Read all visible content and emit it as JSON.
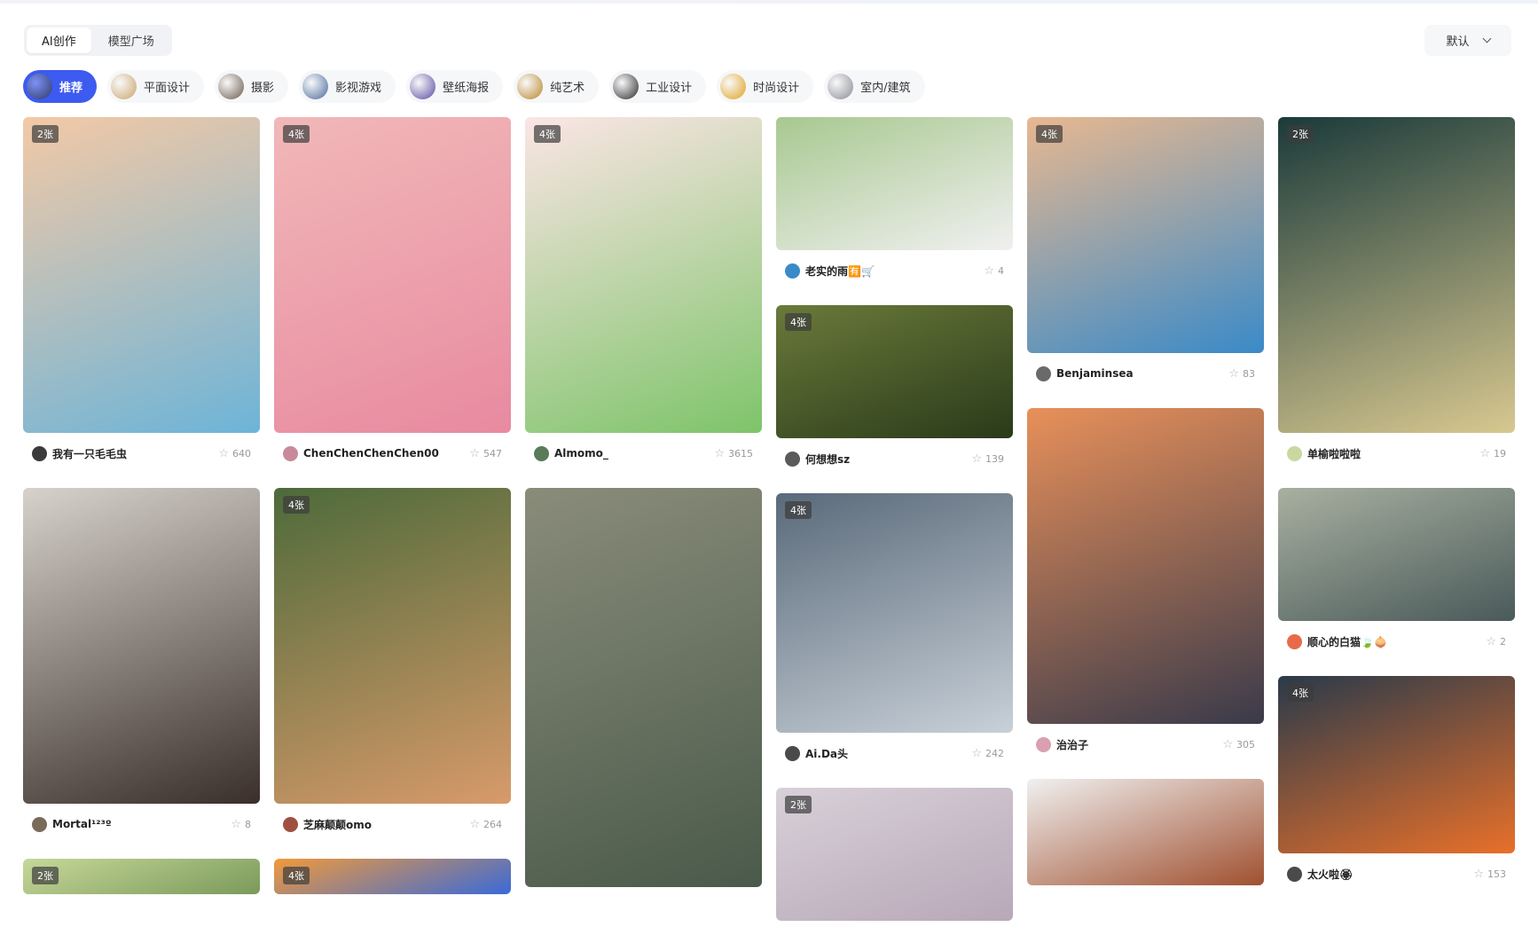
{
  "mode_tabs": [
    "AI创作",
    "模型广场"
  ],
  "sort": {
    "label": "默认",
    "icon": "chevron-down-icon"
  },
  "categories": [
    {
      "label": "推荐",
      "active": true,
      "color": "#2d3a66"
    },
    {
      "label": "平面设计",
      "active": false,
      "color": "#c9a46a"
    },
    {
      "label": "摄影",
      "active": false,
      "color": "#6b5a4a"
    },
    {
      "label": "影视游戏",
      "active": false,
      "color": "#4a6a9a"
    },
    {
      "label": "壁纸海报",
      "active": false,
      "color": "#5a4aa0"
    },
    {
      "label": "纯艺术",
      "active": false,
      "color": "#b8862a"
    },
    {
      "label": "工业设计",
      "active": false,
      "color": "#2a2a2a"
    },
    {
      "label": "时尚设计",
      "active": false,
      "color": "#e0a020"
    },
    {
      "label": "室内/建筑",
      "active": false,
      "color": "#8a8a94"
    }
  ],
  "columns": [
    [
      {
        "badge": "2张",
        "user": "我有一只毛毛虫",
        "fav": "640",
        "c1": "#f3c9a6",
        "c2": "#6db4d8",
        "avatar": "#3a3a3a"
      },
      {
        "badge": "",
        "user": "Mortal¹²³º",
        "fav": "8",
        "c1": "#d7d2cc",
        "c2": "#3a2f2a",
        "avatar": "#7a6a5a"
      },
      {
        "badge": "2张",
        "user": "",
        "fav": "",
        "c1": "#c7d89a",
        "c2": "#7a9a5a",
        "avatar": "#888"
      }
    ],
    [
      {
        "badge": "4张",
        "user": "ChenChenChenChen00",
        "fav": "547",
        "c1": "#f1b8b8",
        "c2": "#e88aa0",
        "avatar": "#c88a9a"
      },
      {
        "badge": "4张",
        "user": "芝麻颠颠omo",
        "fav": "264",
        "c1": "#4d6a3a",
        "c2": "#d89a6a",
        "avatar": "#a05040"
      },
      {
        "badge": "4张",
        "user": "",
        "fav": "",
        "c1": "#f29a3a",
        "c2": "#3a6ad8",
        "avatar": "#888"
      }
    ],
    [
      {
        "badge": "4张",
        "user": "Almomo_",
        "fav": "3615",
        "c1": "#fbe5e5",
        "c2": "#7ec46a",
        "avatar": "#5a7a5a"
      },
      {
        "badge": "",
        "user": "",
        "fav": "",
        "c1": "#8a8c7a",
        "c2": "#4a5a4a",
        "avatar": "#888"
      }
    ],
    [
      {
        "badge": "",
        "user": "老实的雨🈶🛒",
        "fav": "4",
        "c1": "#a8c890",
        "c2": "#f0f0f0",
        "avatar": "#3a8ac8"
      },
      {
        "badge": "4张",
        "user": "何想想sz",
        "fav": "139",
        "c1": "#6a7a3a",
        "c2": "#2a3a1a",
        "avatar": "#5a5a5a"
      },
      {
        "badge": "4张",
        "user": "Ai.Da头",
        "fav": "242",
        "c1": "#5a6a7a",
        "c2": "#c8d0d8",
        "avatar": "#4a4a4a"
      },
      {
        "badge": "2张",
        "user": "",
        "fav": "",
        "c1": "#d8d0d8",
        "c2": "#b8a8b8",
        "avatar": "#888"
      }
    ],
    [
      {
        "badge": "4张",
        "user": "Benjaminsea",
        "fav": "83",
        "c1": "#e8b890",
        "c2": "#3a8ac8",
        "avatar": "#6a6a6a"
      },
      {
        "badge": "",
        "user": "治治子",
        "fav": "305",
        "c1": "#e8905a",
        "c2": "#3a3a4a",
        "avatar": "#d8a0b0"
      },
      {
        "badge": "",
        "user": "",
        "fav": "",
        "c1": "#f0f0f0",
        "c2": "#a05030",
        "avatar": "#888"
      }
    ],
    [
      {
        "badge": "2张",
        "user": "",
        "fav": "19",
        "c1": "#1a3a3a",
        "c2": "#d8c890",
        "avatar": "#c8d8a0"
      },
      {
        "badge": "",
        "user": "顺心的白猫🍃🧅",
        "fav": "2",
        "c1": "#a8b0a0",
        "c2": "#4a5a5a",
        "avatar": "#e86a4a"
      },
      {
        "badge": "4张",
        "user": "太火啦🏵",
        "fav": "153",
        "c1": "#2a3a4a",
        "c2": "#e8702a",
        "avatar": "#4a4a4a"
      }
    ]
  ],
  "extra_labels": {
    "col6_card1_user": "单榆啦啦啦"
  }
}
